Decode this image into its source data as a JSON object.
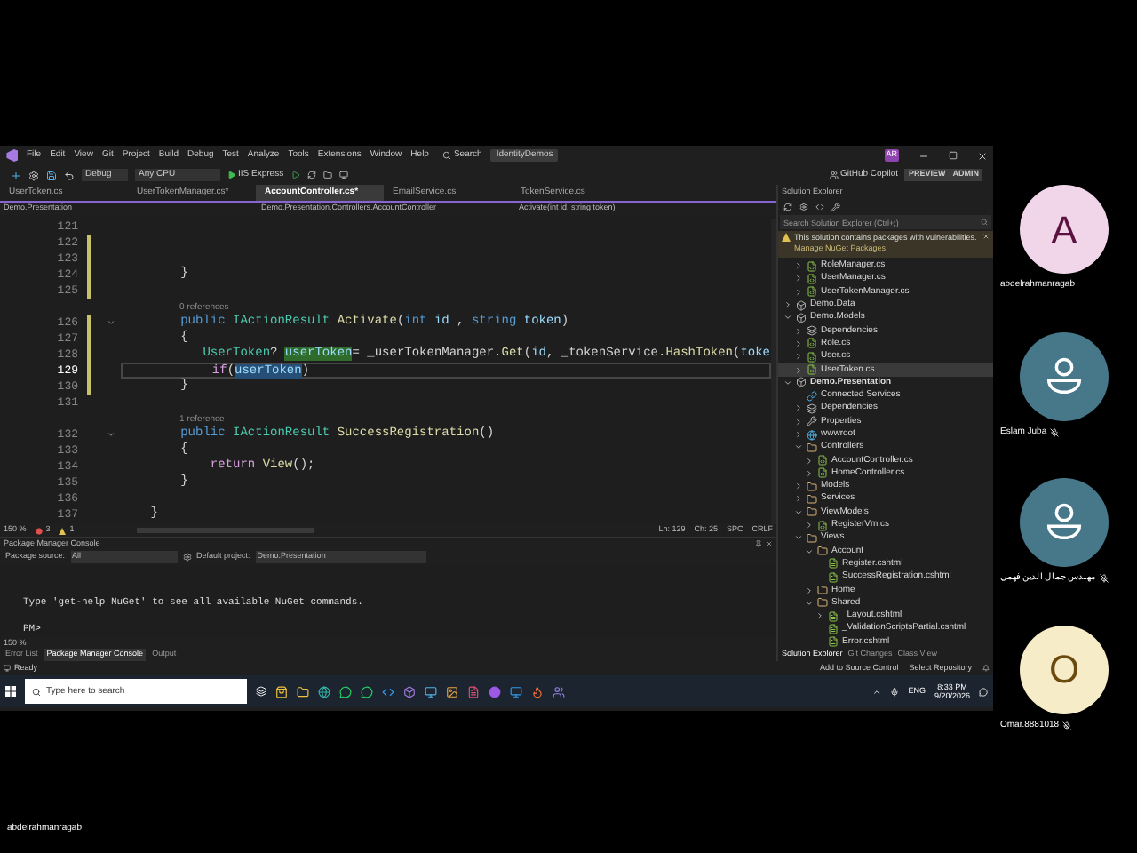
{
  "window": {
    "title": "IdentityDemos",
    "menu": [
      "File",
      "Edit",
      "View",
      "Git",
      "Project",
      "Build",
      "Debug",
      "Test",
      "Analyze",
      "Tools",
      "Extensions",
      "Window",
      "Help"
    ],
    "search": "Search",
    "user_initials": "AR"
  },
  "toolbar": {
    "configuration": "Debug",
    "platform": "Any CPU",
    "run_target": "IIS Express",
    "copilot": "GitHub Copilot",
    "preview": "PREVIEW",
    "admin": "ADMIN"
  },
  "tabs": [
    {
      "label": "UserToken.cs",
      "selected": false
    },
    {
      "label": "UserTokenManager.cs*",
      "selected": false
    },
    {
      "label": "AccountController.cs*",
      "selected": true
    },
    {
      "label": "EmailService.cs",
      "selected": false
    },
    {
      "label": "TokenService.cs",
      "selected": false
    }
  ],
  "navigation_bar": [
    "Demo.Presentation",
    "Demo.Presentation.Controllers.AccountController",
    "Activate(int id, string token)"
  ],
  "editor": {
    "lines": [
      {
        "kind": "code",
        "number": "121",
        "current": false,
        "changed": false,
        "foldable": false
      },
      {
        "kind": "code",
        "number": "122",
        "current": false,
        "changed": true,
        "foldable": false
      },
      {
        "kind": "code",
        "number": "123",
        "current": false,
        "changed": true,
        "foldable": false
      },
      {
        "kind": "code",
        "number": "124",
        "current": false,
        "changed": true,
        "foldable": false,
        "tokens": [
          {
            "text": "        }",
            "kind": "plain"
          }
        ]
      },
      {
        "kind": "code",
        "number": "125",
        "current": false,
        "changed": true,
        "foldable": false
      },
      {
        "kind": "lens",
        "text": "0 references"
      },
      {
        "kind": "code",
        "number": "126",
        "current": false,
        "changed": true,
        "foldable": true,
        "tokens": [
          {
            "text": "        public ",
            "kind": "keyword"
          },
          {
            "text": "IActionResult ",
            "kind": "type"
          },
          {
            "text": "Activate",
            "kind": "method"
          },
          {
            "text": "(",
            "kind": "plain"
          },
          {
            "text": "int ",
            "kind": "keyword"
          },
          {
            "text": "id",
            "kind": "parameter"
          },
          {
            "text": " , ",
            "kind": "plain"
          },
          {
            "text": "string ",
            "kind": "keyword"
          },
          {
            "text": "token",
            "kind": "parameter"
          },
          {
            "text": ")",
            "kind": "plain"
          }
        ]
      },
      {
        "kind": "code",
        "number": "127",
        "current": false,
        "changed": true,
        "foldable": false,
        "tokens": [
          {
            "text": "        {",
            "kind": "plain"
          }
        ]
      },
      {
        "kind": "code",
        "number": "128",
        "current": false,
        "changed": true,
        "foldable": false,
        "tokens": [
          {
            "text": "           UserToken",
            "kind": "type"
          },
          {
            "text": "? ",
            "kind": "plain"
          },
          {
            "text": "userToken",
            "kind": "reference-highlight"
          },
          {
            "text": "= _userTokenManager.",
            "kind": "plain"
          },
          {
            "text": "Get",
            "kind": "method"
          },
          {
            "text": "(",
            "kind": "plain"
          },
          {
            "text": "id",
            "kind": "parameter"
          },
          {
            "text": ", _tokenService.",
            "kind": "plain"
          },
          {
            "text": "HashToken",
            "kind": "method"
          },
          {
            "text": "(",
            "kind": "plain"
          },
          {
            "text": "toke",
            "kind": "parameter"
          }
        ]
      },
      {
        "kind": "code",
        "number": "129",
        "current": true,
        "changed": true,
        "foldable": false,
        "tokens": [
          {
            "text": "            if",
            "kind": "control"
          },
          {
            "text": "(",
            "kind": "plain"
          },
          {
            "text": "userToken",
            "kind": "selection"
          },
          {
            "text": ")",
            "kind": "plain"
          }
        ]
      },
      {
        "kind": "code",
        "number": "130",
        "current": false,
        "changed": true,
        "foldable": false,
        "tokens": [
          {
            "text": "        }",
            "kind": "plain"
          }
        ]
      },
      {
        "kind": "code",
        "number": "131",
        "current": false,
        "changed": false,
        "foldable": false
      },
      {
        "kind": "lens",
        "text": "1 reference"
      },
      {
        "kind": "code",
        "number": "132",
        "current": false,
        "changed": false,
        "foldable": true,
        "tokens": [
          {
            "text": "        public ",
            "kind": "keyword"
          },
          {
            "text": "IActionResult ",
            "kind": "type"
          },
          {
            "text": "SuccessRegistration",
            "kind": "method"
          },
          {
            "text": "()",
            "kind": "plain"
          }
        ]
      },
      {
        "kind": "code",
        "number": "133",
        "current": false,
        "changed": false,
        "foldable": false,
        "tokens": [
          {
            "text": "        {",
            "kind": "plain"
          }
        ]
      },
      {
        "kind": "code",
        "number": "134",
        "current": false,
        "changed": false,
        "foldable": false,
        "tokens": [
          {
            "text": "            return ",
            "kind": "control"
          },
          {
            "text": "View",
            "kind": "method"
          },
          {
            "text": "();",
            "kind": "plain"
          }
        ]
      },
      {
        "kind": "code",
        "number": "135",
        "current": false,
        "changed": false,
        "foldable": false,
        "tokens": [
          {
            "text": "        }",
            "kind": "plain"
          }
        ]
      },
      {
        "kind": "code",
        "number": "136",
        "current": false,
        "changed": false,
        "foldable": false
      },
      {
        "kind": "code",
        "number": "137",
        "current": false,
        "changed": false,
        "foldable": false,
        "tokens": [
          {
            "text": "    }",
            "kind": "plain"
          }
        ]
      }
    ],
    "status": {
      "zoom": "150 %",
      "errors": "3",
      "warnings": "1",
      "line": "Ln: 129",
      "column": "Ch: 25",
      "whitespace": "SPC",
      "line_ending": "CRLF"
    }
  },
  "console": {
    "title": "Package Manager Console",
    "source_label": "Package source:",
    "source": "All",
    "project_label": "Default project:",
    "project": "Demo.Presentation",
    "output": [
      "Type 'get-help NuGet' to see all available NuGet commands.",
      "PM>"
    ],
    "zoom": "150 %"
  },
  "bottom_tabs": [
    {
      "label": "Error List",
      "selected": false
    },
    {
      "label": "Package Manager Console",
      "selected": true
    },
    {
      "label": "Output",
      "selected": false
    }
  ],
  "solution_explorer": {
    "title": "Solution Explorer",
    "search_placeholder": "Search Solution Explorer (Ctrl+;)",
    "warning": {
      "message": "This solution contains packages with vulnerabilities.",
      "link": "Manage NuGet Packages"
    },
    "tree": [
      {
        "children": [
          {
            "label": "RoleManager.cs",
            "kind": "cs",
            "expanded": false,
            "selected": false
          },
          {
            "label": "UserManager.cs",
            "kind": "cs",
            "expanded": false,
            "selected": false
          },
          {
            "label": "UserTokenManager.cs",
            "kind": "cs",
            "expanded": false,
            "selected": false
          }
        ]
      },
      {
        "label": "Demo.Data",
        "kind": "project",
        "startup": false,
        "expanded": false,
        "selected": false
      },
      {
        "label": "Demo.Models",
        "kind": "project",
        "startup": false,
        "expanded": true,
        "selected": false,
        "children": [
          {
            "label": "Dependencies",
            "kind": "dependencies",
            "expanded": false,
            "selected": false
          },
          {
            "label": "Role.cs",
            "kind": "cs",
            "expanded": false,
            "selected": false
          },
          {
            "label": "User.cs",
            "kind": "cs",
            "expanded": false,
            "selected": false
          },
          {
            "label": "UserToken.cs",
            "kind": "cs",
            "expanded": false,
            "selected": true
          }
        ]
      },
      {
        "label": "Demo.Presentation",
        "kind": "project",
        "startup": true,
        "expanded": true,
        "selected": false,
        "children": [
          {
            "label": "Connected Services",
            "kind": "services",
            "selected": false
          },
          {
            "label": "Dependencies",
            "kind": "dependencies",
            "expanded": false,
            "selected": false
          },
          {
            "label": "Properties",
            "kind": "properties",
            "expanded": false,
            "selected": false
          },
          {
            "label": "wwwroot",
            "kind": "web",
            "expanded": false,
            "selected": false
          },
          {
            "label": "Controllers",
            "kind": "folder",
            "expanded": true,
            "selected": false,
            "children": [
              {
                "label": "AccountController.cs",
                "kind": "cs",
                "expanded": false,
                "selected": false
              },
              {
                "label": "HomeController.cs",
                "kind": "cs",
                "expanded": false,
                "selected": false
              }
            ]
          },
          {
            "label": "Models",
            "kind": "folder",
            "expanded": false,
            "selected": false
          },
          {
            "label": "Services",
            "kind": "folder",
            "expanded": false,
            "selected": false
          },
          {
            "label": "ViewModels",
            "kind": "folder",
            "expanded": true,
            "selected": false,
            "children": [
              {
                "label": "RegisterVm.cs",
                "kind": "cs",
                "expanded": false,
                "selected": false
              }
            ]
          },
          {
            "label": "Views",
            "kind": "folder",
            "expanded": true,
            "selected": false,
            "children": [
              {
                "label": "Account",
                "kind": "folder",
                "expanded": true,
                "selected": false,
                "children": [
                  {
                    "label": "Register.cshtml",
                    "kind": "razor",
                    "selected": false
                  },
                  {
                    "label": "SuccessRegistration.cshtml",
                    "kind": "razor",
                    "selected": false
                  }
                ]
              },
              {
                "label": "Home",
                "kind": "folder",
                "expanded": false,
                "selected": false
              },
              {
                "label": "Shared",
                "kind": "folder",
                "expanded": true,
                "selected": false,
                "children": [
                  {
                    "label": "_Layout.cshtml",
                    "kind": "razor",
                    "expanded": false,
                    "selected": false
                  },
                  {
                    "label": "_ValidationScriptsPartial.cshtml",
                    "kind": "razor",
                    "selected": false
                  },
                  {
                    "label": "Error.cshtml",
                    "kind": "razor",
                    "selected": false
                  }
                ]
              }
            ]
          }
        ]
      }
    ],
    "tabs": [
      {
        "label": "Solution Explorer",
        "selected": true
      },
      {
        "label": "Git Changes",
        "selected": false
      },
      {
        "label": "Class View",
        "selected": false
      }
    ]
  },
  "status_bar": {
    "message": "Ready",
    "source_control": "Add to Source Control",
    "repository": "Select Repository"
  },
  "taskbar": {
    "search_placeholder": "Type here to search",
    "language": "ENG",
    "time": "8:33 PM",
    "date": "9/20/2026"
  },
  "participants": [
    {
      "name": "abdelrahmanragab",
      "kind": "initial",
      "initial": "A",
      "color": "#f0d6e8",
      "muted": false
    },
    {
      "name": "Eslam Juba",
      "kind": "silhouette",
      "color": "#46788a",
      "muted": true
    },
    {
      "name": "مهندس جمال الدين فهمي",
      "kind": "silhouette",
      "color": "#46788a",
      "muted": true
    },
    {
      "name": "Omar.8881018",
      "kind": "initial",
      "initial": "O",
      "color": "#f7ecc8",
      "muted": true
    }
  ],
  "presenter": "abdelrahmanragab"
}
